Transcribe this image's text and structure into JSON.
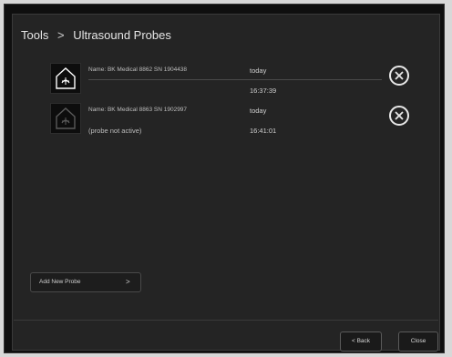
{
  "header": {
    "breadcrumb_root": "Tools",
    "breadcrumb_separator": ">",
    "breadcrumb_current": "Ultrasound Probes"
  },
  "probes": [
    {
      "name": "Name: BK Medical 8862 SN 1904438",
      "status": "",
      "date": "today",
      "time": "16:37:39",
      "active": true
    },
    {
      "name": "Name: BK Medical 8863 SN 1902997",
      "status": "(probe not active)",
      "date": "today",
      "time": "16:41:01",
      "active": false
    }
  ],
  "actions": {
    "add_probe_label": "Add New Probe",
    "add_probe_chevron": ">",
    "back_label": "< Back",
    "close_label": "Close"
  },
  "colors": {
    "panel_background": "#242424",
    "text": "#e6e6e6",
    "icon_active": "#ffffff",
    "icon_inactive": "#5a5a5a"
  }
}
